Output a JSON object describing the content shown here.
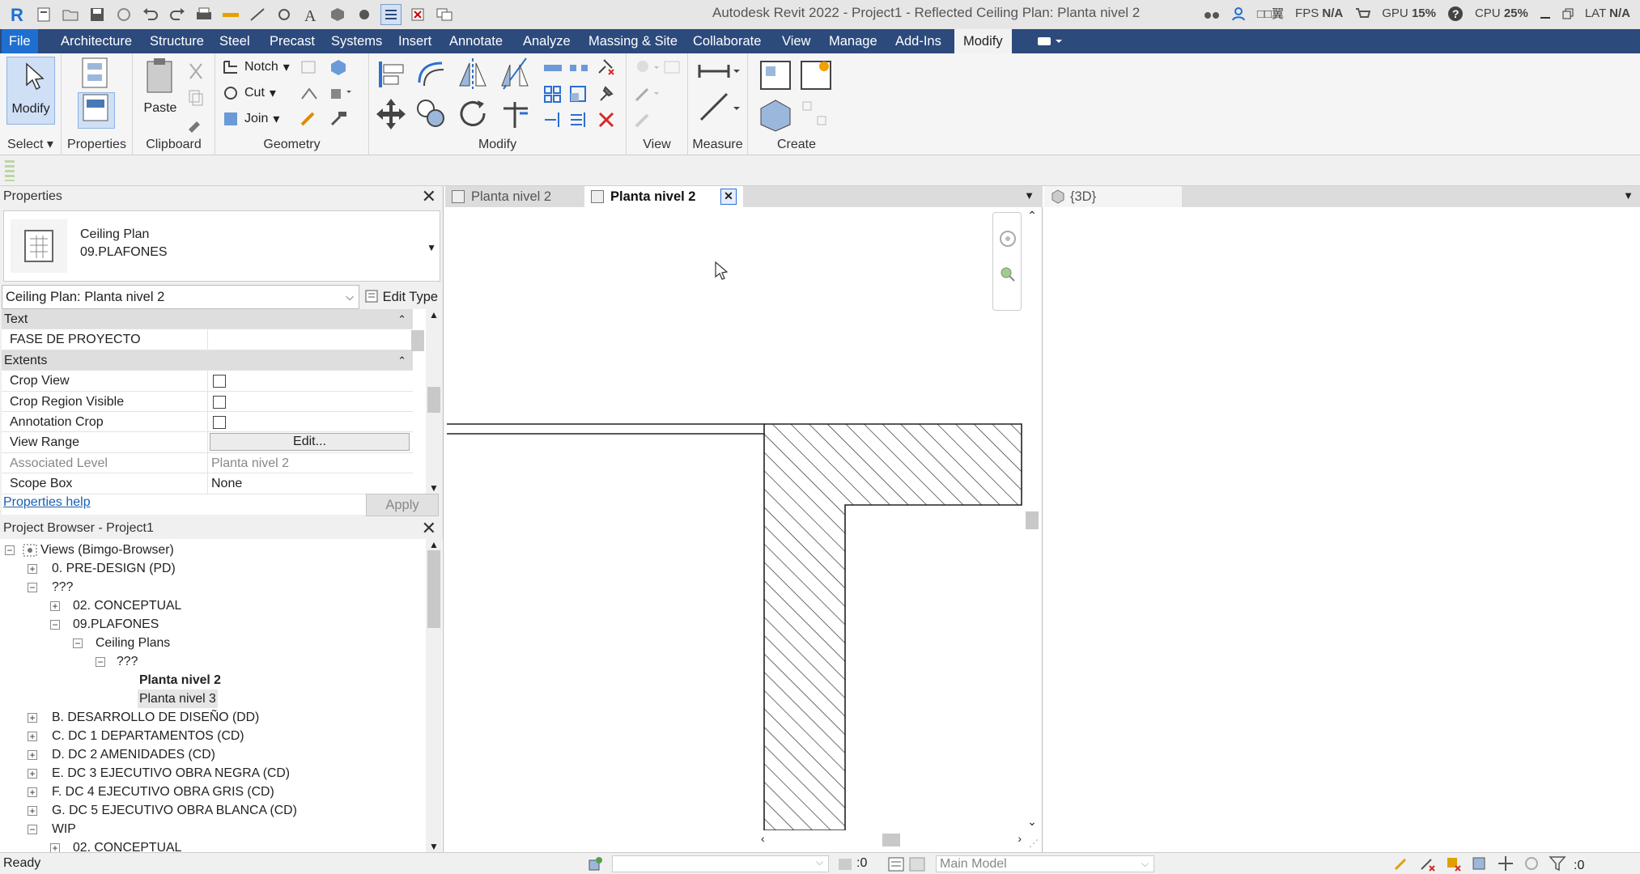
{
  "window": {
    "title": "Autodesk Revit 2022 - Project1 - Reflected Ceiling Plan: Planta nivel 2",
    "lang_indicator": "□□翼",
    "fps_label": "FPS",
    "fps_value": "N/A",
    "gpu_label": "GPU",
    "gpu_value": "15%",
    "cpu_label": "CPU",
    "cpu_value": "25%",
    "lat_label": "LAT",
    "lat_value": "N/A"
  },
  "quick_access": [
    "revit-logo-icon",
    "open-icon",
    "open-folder-icon",
    "save-icon",
    "sync-icon",
    "undo-icon",
    "redo-icon",
    "print-icon",
    "measure-icon",
    "aligned-dimension-icon",
    "tag-icon",
    "text-icon",
    "3d-view-icon",
    "section-icon",
    "thin-lines-icon",
    "close-hidden-icon",
    "switch-windows-icon"
  ],
  "ribbon_tabs": [
    "File",
    "Architecture",
    "Structure",
    "Steel",
    "Precast",
    "Systems",
    "Insert",
    "Annotate",
    "Analyze",
    "Massing & Site",
    "Collaborate",
    "View",
    "Manage",
    "Add-Ins",
    "Modify"
  ],
  "active_tab": "Modify",
  "ribbon": {
    "modify_label": "Modify",
    "select_label": "Select",
    "properties_label": "Properties",
    "paste_label": "Paste",
    "clipboard_label": "Clipboard",
    "notch_label": "Notch",
    "cut_label": "Cut",
    "join_label": "Join",
    "geometry_label": "Geometry",
    "modify_panel_label": "Modify",
    "view_label": "View",
    "measure_label": "Measure",
    "create_label": "Create"
  },
  "properties": {
    "title": "Properties",
    "type_name": "Ceiling Plan",
    "type_subname": "09.PLAFONES",
    "instance_selector": "Ceiling Plan: Planta nivel 2",
    "edit_type": "Edit Type",
    "rows": [
      {
        "kind": "cat",
        "key": "Text",
        "value": ""
      },
      {
        "kind": "val",
        "key": "FASE DE PROYECTO",
        "value": ""
      },
      {
        "kind": "cat",
        "key": "Extents",
        "value": ""
      },
      {
        "kind": "check",
        "key": "Crop View",
        "value": ""
      },
      {
        "kind": "check",
        "key": "Crop Region Visible",
        "value": ""
      },
      {
        "kind": "check",
        "key": "Annotation Crop",
        "value": ""
      },
      {
        "kind": "button",
        "key": "View Range",
        "value": "Edit..."
      },
      {
        "kind": "dim",
        "key": "Associated Level",
        "value": "Planta nivel 2"
      },
      {
        "kind": "val",
        "key": "Scope Box",
        "value": "None"
      }
    ],
    "help_link": "Properties help",
    "apply": "Apply"
  },
  "browser": {
    "title": "Project Browser - Project1",
    "nodes": [
      {
        "label": "Views (Bimgo-Browser)",
        "level": 0,
        "box": "−",
        "icon": true
      },
      {
        "label": "0. PRE-DESIGN (PD)",
        "level": 1,
        "box": "+"
      },
      {
        "label": "???",
        "level": 1,
        "box": "−"
      },
      {
        "label": "02. CONCEPTUAL",
        "level": 2,
        "box": "+"
      },
      {
        "label": "09.PLAFONES",
        "level": 2,
        "box": "−"
      },
      {
        "label": "Ceiling Plans",
        "level": 3,
        "box": "−"
      },
      {
        "label": "???",
        "level": 4,
        "box": "−"
      },
      {
        "label": "Planta nivel 2",
        "level": 5,
        "box": "",
        "bold": true
      },
      {
        "label": "Planta nivel 3",
        "level": 5,
        "box": "",
        "sel": true
      },
      {
        "label": "B. DESARROLLO DE DISEÑO (DD)",
        "level": 1,
        "box": "+"
      },
      {
        "label": "C. DC 1 DEPARTAMENTOS (CD)",
        "level": 1,
        "box": "+"
      },
      {
        "label": "D. DC 2 AMENIDADES (CD)",
        "level": 1,
        "box": "+"
      },
      {
        "label": "E. DC 3 EJECUTIVO OBRA NEGRA (CD)",
        "level": 1,
        "box": "+"
      },
      {
        "label": "F. DC 4 EJECUTIVO OBRA GRIS (CD)",
        "level": 1,
        "box": "+"
      },
      {
        "label": "G. DC 5 EJECUTIVO OBRA BLANCA (CD)",
        "level": 1,
        "box": "+"
      },
      {
        "label": "WIP",
        "level": 1,
        "box": "−"
      },
      {
        "label": "02. CONCEPTUAL",
        "level": 2,
        "box": "+"
      }
    ]
  },
  "view_tabs": {
    "tab1": "Planta nivel 2",
    "tab2": "Planta nivel 2",
    "tab3": "{3D}"
  },
  "status": {
    "text": "Ready",
    "workset_value": ":0",
    "model": "Main Model",
    "filter_count": ":0"
  },
  "colors": {
    "ribbon_tab_bg": "#2c4a7c",
    "file_tab": "#1f6fd1",
    "accent_blue": "#1a5fb4",
    "delete_red": "#d62a2a"
  }
}
